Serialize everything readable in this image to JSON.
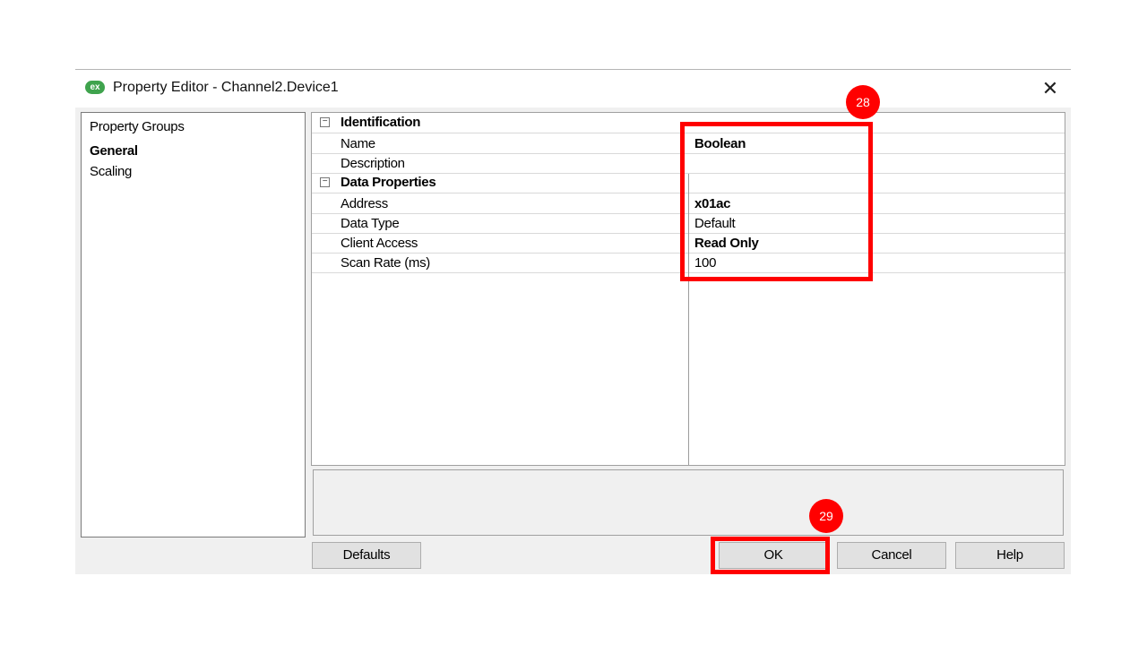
{
  "window": {
    "title": "Property Editor - Channel2.Device1",
    "app_icon_text": "ex",
    "close_glyph": "✕"
  },
  "property_groups": {
    "header": "Property Groups",
    "items": [
      {
        "label": "General",
        "selected": true
      },
      {
        "label": "Scaling",
        "selected": false
      }
    ]
  },
  "grid": {
    "categories": [
      {
        "title": "Identification",
        "expander": "−",
        "rows": [
          {
            "key": "Name",
            "value": "Boolean"
          },
          {
            "key": "Description",
            "value": ""
          }
        ]
      },
      {
        "title": "Data Properties",
        "expander": "−",
        "rows": [
          {
            "key": "Address",
            "value": "x01ac"
          },
          {
            "key": "Data Type",
            "value": "Default"
          },
          {
            "key": "Client Access",
            "value": "Read Only"
          },
          {
            "key": "Scan Rate (ms)",
            "value": "100"
          }
        ]
      }
    ]
  },
  "buttons": {
    "defaults": "Defaults",
    "ok": "OK",
    "cancel": "Cancel",
    "help": "Help"
  },
  "annotations": {
    "step_28": "28",
    "step_29": "29",
    "color": "#ff0000"
  },
  "colors": {
    "dialog_bg": "#f0f0f0",
    "button_bg": "#e1e1e1",
    "app_icon": "#3fa34d"
  }
}
